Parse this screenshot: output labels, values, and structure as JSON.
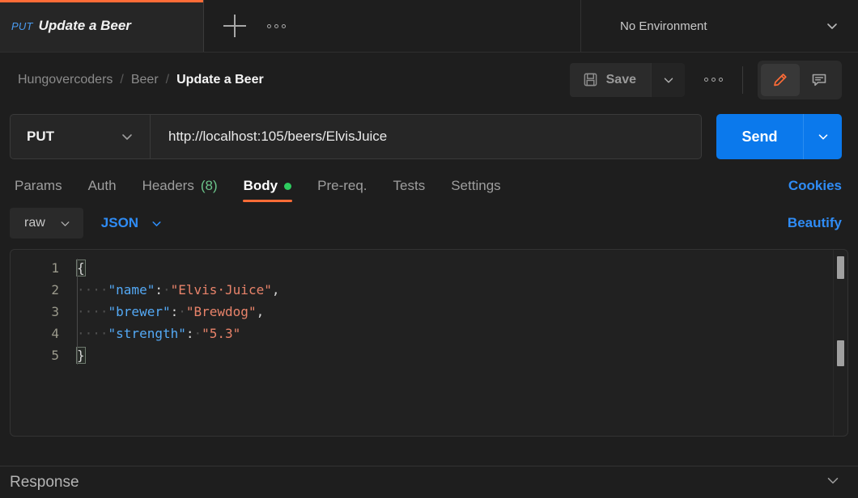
{
  "tabstrip": {
    "request_tab": {
      "method": "PUT",
      "title": "Update a Beer"
    },
    "new_tab_label": "+",
    "tab_menu_label": "•••",
    "environment": {
      "value": "No Environment"
    }
  },
  "breadcrumb": {
    "workspace": "Hungovercoders",
    "collection": "Beer",
    "request": "Update a Beer",
    "separator": "/"
  },
  "toolbar": {
    "save_label": "Save",
    "save_caret": "chevron-down",
    "more_label": "•••",
    "edit_icon": "pencil-icon",
    "comment_icon": "comment-icon"
  },
  "request": {
    "method": "PUT",
    "url": "http://localhost:105/beers/ElvisJuice",
    "send_label": "Send"
  },
  "section_tabs": [
    {
      "label": "Params",
      "active": false
    },
    {
      "label": "Auth",
      "active": false
    },
    {
      "label": "Headers",
      "count": "(8)",
      "active": false
    },
    {
      "label": "Body",
      "active": true,
      "dot": true
    },
    {
      "label": "Pre-req.",
      "active": false
    },
    {
      "label": "Tests",
      "active": false
    },
    {
      "label": "Settings",
      "active": false
    }
  ],
  "cookies_link": "Cookies",
  "body_controls": {
    "mode": "raw",
    "format": "JSON",
    "beautify": "Beautify"
  },
  "editor": {
    "line_numbers": [
      "1",
      "2",
      "3",
      "4",
      "5"
    ],
    "lines": [
      {
        "open_brace": "{"
      },
      {
        "indent": "····",
        "key": "\"name\"",
        "colon": ":",
        "space": "·",
        "value": "\"Elvis·Juice\"",
        "comma": ","
      },
      {
        "indent": "····",
        "key": "\"brewer\"",
        "colon": ":",
        "space": "·",
        "value": "\"Brewdog\"",
        "comma": ","
      },
      {
        "indent": "····",
        "key": "\"strength\"",
        "colon": ":",
        "space": "·",
        "value": "\"5.3\"",
        "comma": ""
      },
      {
        "close_brace": "}"
      }
    ]
  },
  "response": {
    "label": "Response",
    "caret": "chevron-down"
  },
  "colors": {
    "accent_orange": "#ff6c37",
    "send_blue": "#0b79ec",
    "link_blue": "#2f8cf5",
    "json_key": "#54a9f5",
    "json_string": "#e8836a",
    "status_green": "#2ecc5f",
    "count_green": "#6bc48a",
    "background": "#1e1e1e",
    "editor_background": "#212121"
  }
}
